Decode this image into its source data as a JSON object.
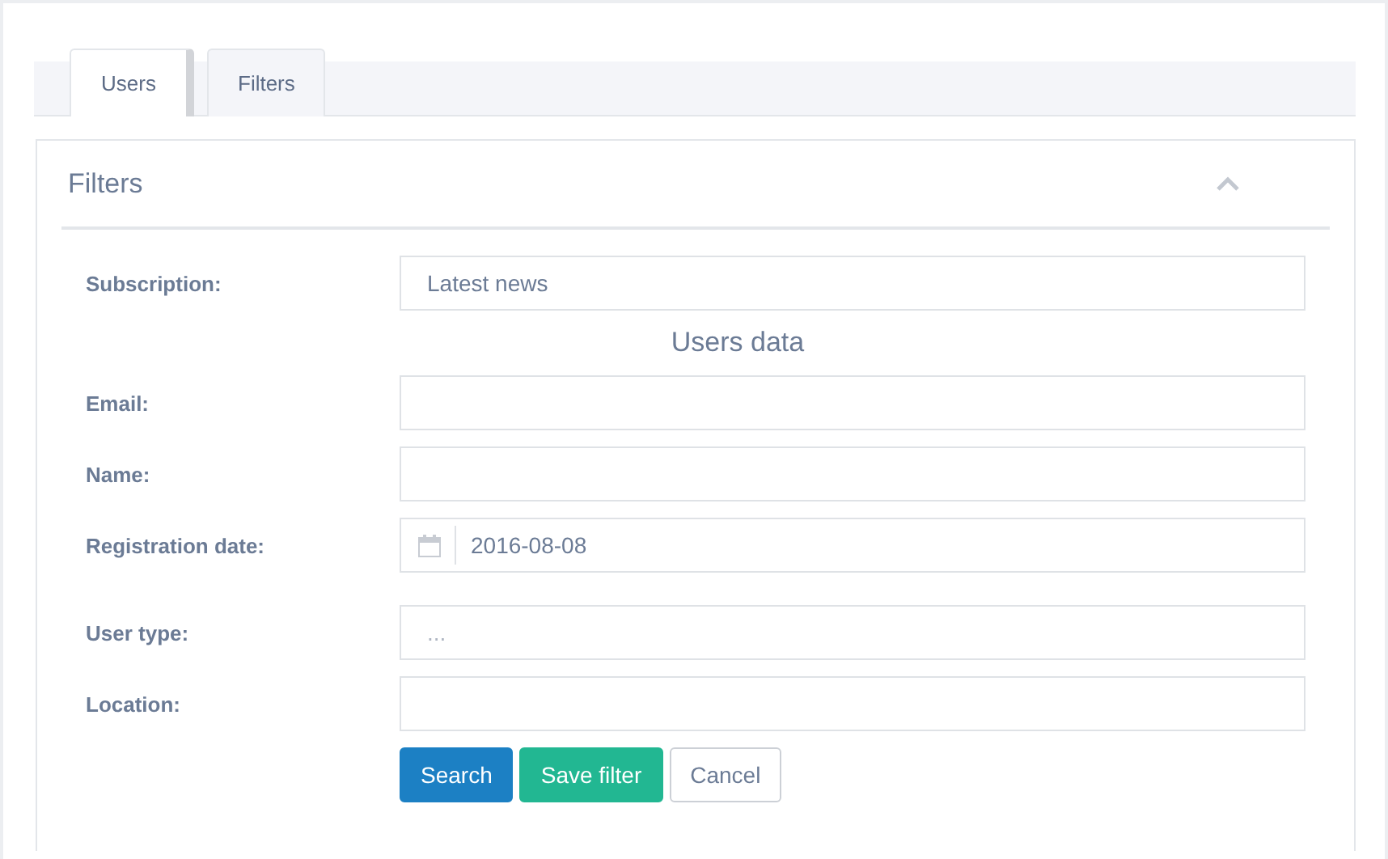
{
  "tabs": [
    {
      "label": "Users",
      "selected": true
    },
    {
      "label": "Filters",
      "selected": false
    }
  ],
  "panel": {
    "title": "Filters",
    "expanded": true,
    "sections": [
      {
        "fields": [
          {
            "label": "Subscription:",
            "kind": "select",
            "value": "Latest news"
          }
        ]
      },
      {
        "title": "Users data",
        "fields": [
          {
            "label": "Email:",
            "kind": "text"
          },
          {
            "label": "Name:",
            "kind": "text"
          },
          {
            "label": "Registration date:",
            "kind": "date",
            "value": "2016-08-08"
          },
          {
            "label": "User type:",
            "kind": "select",
            "placeholder": "..."
          },
          {
            "label": "Location:",
            "kind": "text"
          }
        ]
      }
    ],
    "buttons": [
      {
        "label": "Search",
        "kind": "primary"
      },
      {
        "label": "Save filter",
        "kind": "success"
      },
      {
        "label": "Cancel",
        "kind": "default"
      }
    ]
  }
}
